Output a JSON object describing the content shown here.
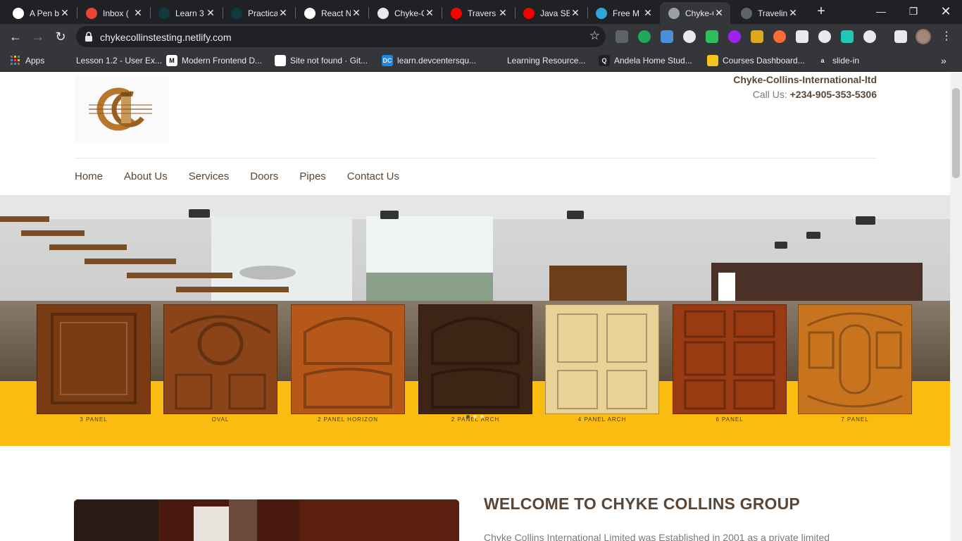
{
  "browser": {
    "tabs": [
      {
        "title": "A Pen b",
        "icon": "codepen-icon",
        "color": "#ffffff"
      },
      {
        "title": "Inbox (",
        "icon": "gmail-icon",
        "color": "#ea4335"
      },
      {
        "title": "Learn 3",
        "icon": "sk-icon",
        "color": "#0f3b3f"
      },
      {
        "title": "Practica",
        "icon": "sk-icon",
        "color": "#0f3b3f"
      },
      {
        "title": "React N",
        "icon": "codepen-icon",
        "color": "#ffffff"
      },
      {
        "title": "Chyke-C",
        "icon": "github-icon",
        "color": "#e8eaed"
      },
      {
        "title": "Travers",
        "icon": "youtube-icon",
        "color": "#ff0000"
      },
      {
        "title": "Java SE",
        "icon": "oracle-icon",
        "color": "#f80000"
      },
      {
        "title": "Free M",
        "icon": "netlify-icon",
        "color": "#2fa6d9"
      },
      {
        "title": "Chyke-C",
        "icon": "globe-icon",
        "color": "#9aa0a6"
      },
      {
        "title": "Travelin",
        "icon": "globe-icon",
        "color": "#5f6368"
      }
    ],
    "url": "chykecollinstesting.netlify.com",
    "bookmarks": [
      {
        "label": "Apps",
        "icon": "apps-grid-icon"
      },
      {
        "label": "Lesson 1.2 - User Ex...",
        "icon": "lesson-icon"
      },
      {
        "label": "Modern Frontend D...",
        "icon": "medium-icon",
        "glyph": "M"
      },
      {
        "label": "Site not found · Git...",
        "icon": "globe-icon"
      },
      {
        "label": "learn.devcentersqu...",
        "icon": "devcenter-icon",
        "glyph": "DC"
      },
      {
        "label": "Learning Resource...",
        "icon": "dash-icon"
      },
      {
        "label": "Andela Home Stud...",
        "icon": "andela-icon",
        "glyph": "Q"
      },
      {
        "label": "Courses Dashboard...",
        "icon": "courses-icon"
      },
      {
        "label": "slide-in",
        "icon": "a-icon",
        "glyph": "a"
      }
    ]
  },
  "header": {
    "company": "Chyke-Collins-International-ltd",
    "call_label": "Call Us:",
    "phone": "+234-905-353-5306"
  },
  "nav": [
    "Home",
    "About Us",
    "Services",
    "Doors",
    "Pipes",
    "Contact Us"
  ],
  "hero": {
    "doors": [
      {
        "label": "3 PANEL",
        "color": "#7a3b12",
        "style": "panel"
      },
      {
        "label": "OVAL",
        "color": "#8a4417",
        "style": "oval"
      },
      {
        "label": "2 PANEL HORIZON",
        "color": "#b5581a",
        "style": "arch2"
      },
      {
        "label": "2 PANEL ARCH",
        "color": "#3e2414",
        "style": "arch2"
      },
      {
        "label": "4 PANEL ARCH",
        "color": "#e9d296",
        "style": "four"
      },
      {
        "label": "6 PANEL",
        "color": "#9a3a12",
        "style": "six"
      },
      {
        "label": "7 PANEL",
        "color": "#c8741f",
        "style": "seven"
      }
    ],
    "slide_count": 3,
    "active_slide": 0
  },
  "about": {
    "heading": "WELCOME TO CHYKE COLLINS GROUP",
    "text": "Chyke Collins International Limited was Established in 2001 as a private limited"
  }
}
